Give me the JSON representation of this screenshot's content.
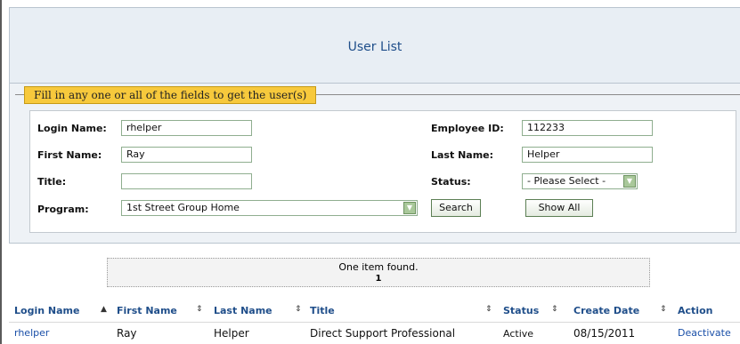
{
  "header": {
    "title": "User List"
  },
  "search": {
    "legend": "Fill in any one or all of the fields to get the user(s)",
    "login_name_label": "Login Name:",
    "login_name_value": "rhelper",
    "employee_id_label": "Employee ID:",
    "employee_id_value": "112233",
    "first_name_label": "First Name:",
    "first_name_value": "Ray",
    "last_name_label": "Last Name:",
    "last_name_value": "Helper",
    "title_label": "Title:",
    "title_value": "",
    "status_label": "Status:",
    "status_value": "- Please Select -",
    "program_label": "Program:",
    "program_value": "1st Street Group Home",
    "search_button": "Search",
    "show_all_button": "Show All"
  },
  "results": {
    "summary": "One item found.",
    "page": "1"
  },
  "table": {
    "columns": [
      "Login Name",
      "First Name",
      "Last Name",
      "Title",
      "Status",
      "Create Date",
      "Action"
    ],
    "rows": [
      {
        "login_name": "rhelper",
        "first_name": "Ray",
        "last_name": "Helper",
        "title": "Direct Support Professional",
        "status": "Active",
        "create_date": "08/15/2011",
        "action": "Deactivate"
      }
    ]
  }
}
